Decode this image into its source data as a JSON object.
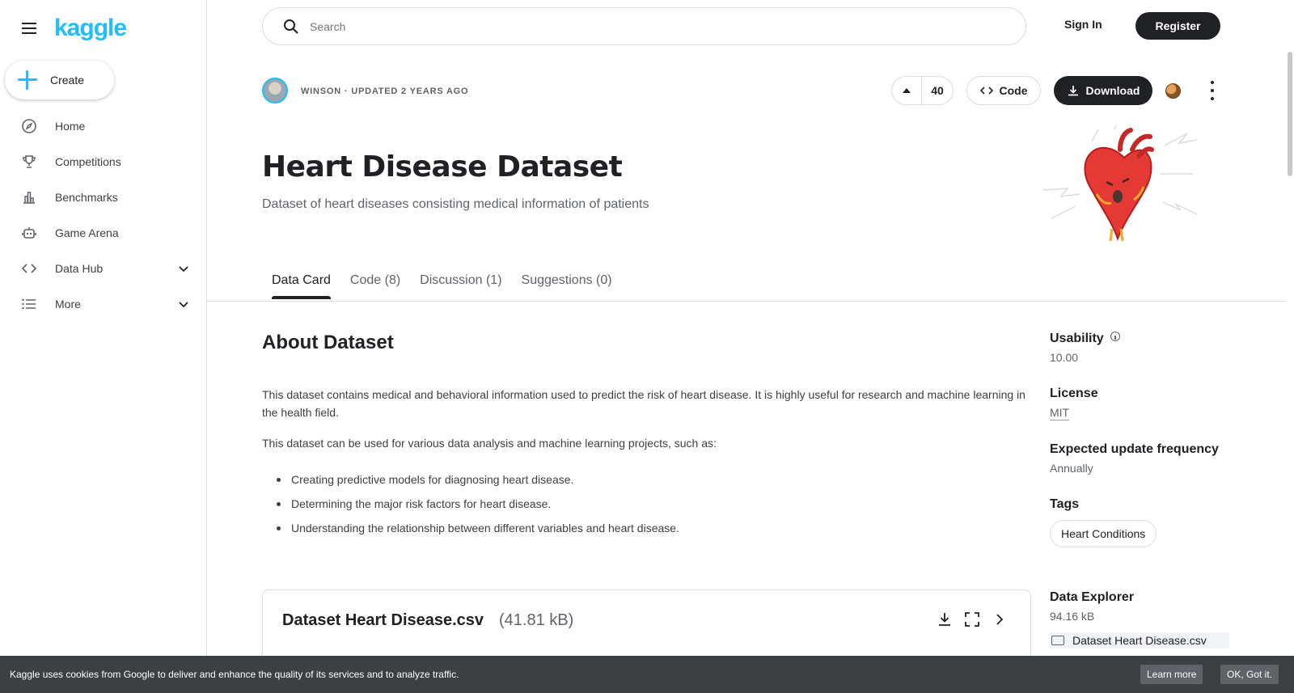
{
  "app": {
    "logo": "kaggle"
  },
  "sidebar": {
    "create_label": "Create",
    "items": [
      {
        "label": "Home",
        "icon": "compass-icon"
      },
      {
        "label": "Competitions",
        "icon": "trophy-icon"
      },
      {
        "label": "Benchmarks",
        "icon": "bar-chart-icon"
      },
      {
        "label": "Game Arena",
        "icon": "robot-icon"
      },
      {
        "label": "Data Hub",
        "icon": "code-icon"
      },
      {
        "label": "More",
        "icon": "list-icon"
      }
    ]
  },
  "topbar": {
    "search_placeholder": "Search",
    "signin_label": "Sign In",
    "register_label": "Register"
  },
  "dataset": {
    "owner_line": "WINSON · UPDATED 2 YEARS AGO",
    "votes": "40",
    "code_label": "Code",
    "download_label": "Download",
    "title": "Heart Disease Dataset",
    "subtitle": "Dataset of heart diseases consisting medical information of patients"
  },
  "tabs": [
    {
      "label": "Data Card",
      "active": true
    },
    {
      "label": "Code (8)"
    },
    {
      "label": "Discussion (1)"
    },
    {
      "label": "Suggestions (0)"
    }
  ],
  "about": {
    "heading": "About Dataset",
    "p1": "This dataset contains medical and behavioral information used to predict the risk of heart disease. It is highly useful for research and machine learning in the health field.",
    "p2": "This dataset can be used for various data analysis and machine learning projects, such as:",
    "bullets": [
      "Creating predictive models for diagnosing heart disease.",
      "Determining the major risk factors for heart disease.",
      "Understanding the relationship between different variables and heart disease."
    ]
  },
  "file_card": {
    "name": "Dataset Heart Disease.csv",
    "size": "(41.81 kB)"
  },
  "meta": {
    "usability_label": "Usability",
    "usability_value": "10.00",
    "license_label": "License",
    "license_value": "MIT",
    "update_label": "Expected update frequency",
    "update_value": "Annually",
    "tags_label": "Tags",
    "tag": "Heart Conditions",
    "explorer_label": "Data Explorer",
    "explorer_size": "94.16 kB",
    "explorer_file": "Dataset Heart Disease.csv"
  },
  "cookie": {
    "text": "Kaggle uses cookies from Google to deliver and enhance the quality of its services and to analyze traffic.",
    "learn_more": "Learn more",
    "ok": "OK, Got it."
  },
  "colors": {
    "accent": "#20beff",
    "dark": "#202124",
    "banner": "#3c4043"
  }
}
